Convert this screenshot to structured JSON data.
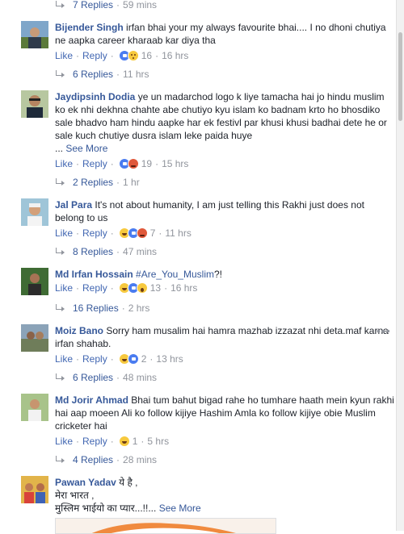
{
  "replies": [
    {
      "count": "7 Replies",
      "time": "59 mins"
    },
    {
      "count": "6 Replies",
      "time": "11 hrs"
    },
    {
      "count": "2 Replies",
      "time": "1 hr"
    },
    {
      "count": "8 Replies",
      "time": "47 mins"
    },
    {
      "count": "16 Replies",
      "time": "2 hrs"
    },
    {
      "count": "6 Replies",
      "time": "48 mins"
    },
    {
      "count": "4 Replies",
      "time": "28 mins"
    }
  ],
  "separator": "·",
  "comments": [
    {
      "name": "Bijender Singh",
      "text": "irfan bhai your my always favourite bhai.... I no dhoni chutiya ne aapka career kharaab kar diya tha",
      "like": "Like",
      "reply": "Reply",
      "reactions": [
        "like",
        "sad"
      ],
      "react_count": "16",
      "time": "16 hrs"
    },
    {
      "name": "Jaydipsinh Dodia",
      "text": "ye un madarchod logo k liye tamacha hai jo hindu muslim ko ek nhi dekhna chahte abe chutiyo kyu islam ko badnam krto ho bhosdiko sale bhadvo ham hindu aapke har ek festivl par khusi khusi badhai dete he or sale kuch chutiye dusra islam leke paida huye",
      "see_more_prefix": "...",
      "see_more": "See More",
      "like": "Like",
      "reply": "Reply",
      "reactions": [
        "like",
        "angry"
      ],
      "react_count": "19",
      "time": "15 hrs"
    },
    {
      "name": "Jal Para",
      "text": "It's not about humanity, I am just telling this Rakhi just does not belong to us",
      "like": "Like",
      "reply": "Reply",
      "reactions": [
        "haha",
        "like",
        "angry"
      ],
      "react_count": "7",
      "time": "11 hrs"
    },
    {
      "name": "Md Irfan Hossain",
      "tag": "#Are_You_Muslim",
      "text_suffix": "?!",
      "like": "Like",
      "reply": "Reply",
      "reactions": [
        "haha",
        "like",
        "wow"
      ],
      "react_count": "13",
      "time": "16 hrs"
    },
    {
      "name": "Moiz Bano",
      "text": "Sorry ham musalim hai hamra mazhab izzazat nhi deta.maf karna irfan shahab.",
      "like": "Like",
      "reply": "Reply",
      "reactions": [
        "haha",
        "like"
      ],
      "react_count": "2",
      "time": "13 hrs"
    },
    {
      "name": "Md Jorir Ahmad",
      "text": "Bhai tum bahut bigad rahe ho tumhare haath mein kyun rakhi hai aap moeen Ali ko follow kijiye Hashim Amla ko follow kijiye obie Muslim cricketer hai",
      "like": "Like",
      "reply": "Reply",
      "reactions": [
        "haha"
      ],
      "react_count": "1",
      "time": "5 hrs"
    },
    {
      "name": "Pawan Yadav",
      "line1": "ये है ,",
      "line2": "मेरा भारत ,",
      "line3": "मुस्लिम भाईयो का प्यार...!!...",
      "see_more": "See More"
    }
  ],
  "more_options": "•••",
  "colors": {
    "link": "#365899",
    "meta": "#90949c",
    "action": "#4267b2"
  }
}
